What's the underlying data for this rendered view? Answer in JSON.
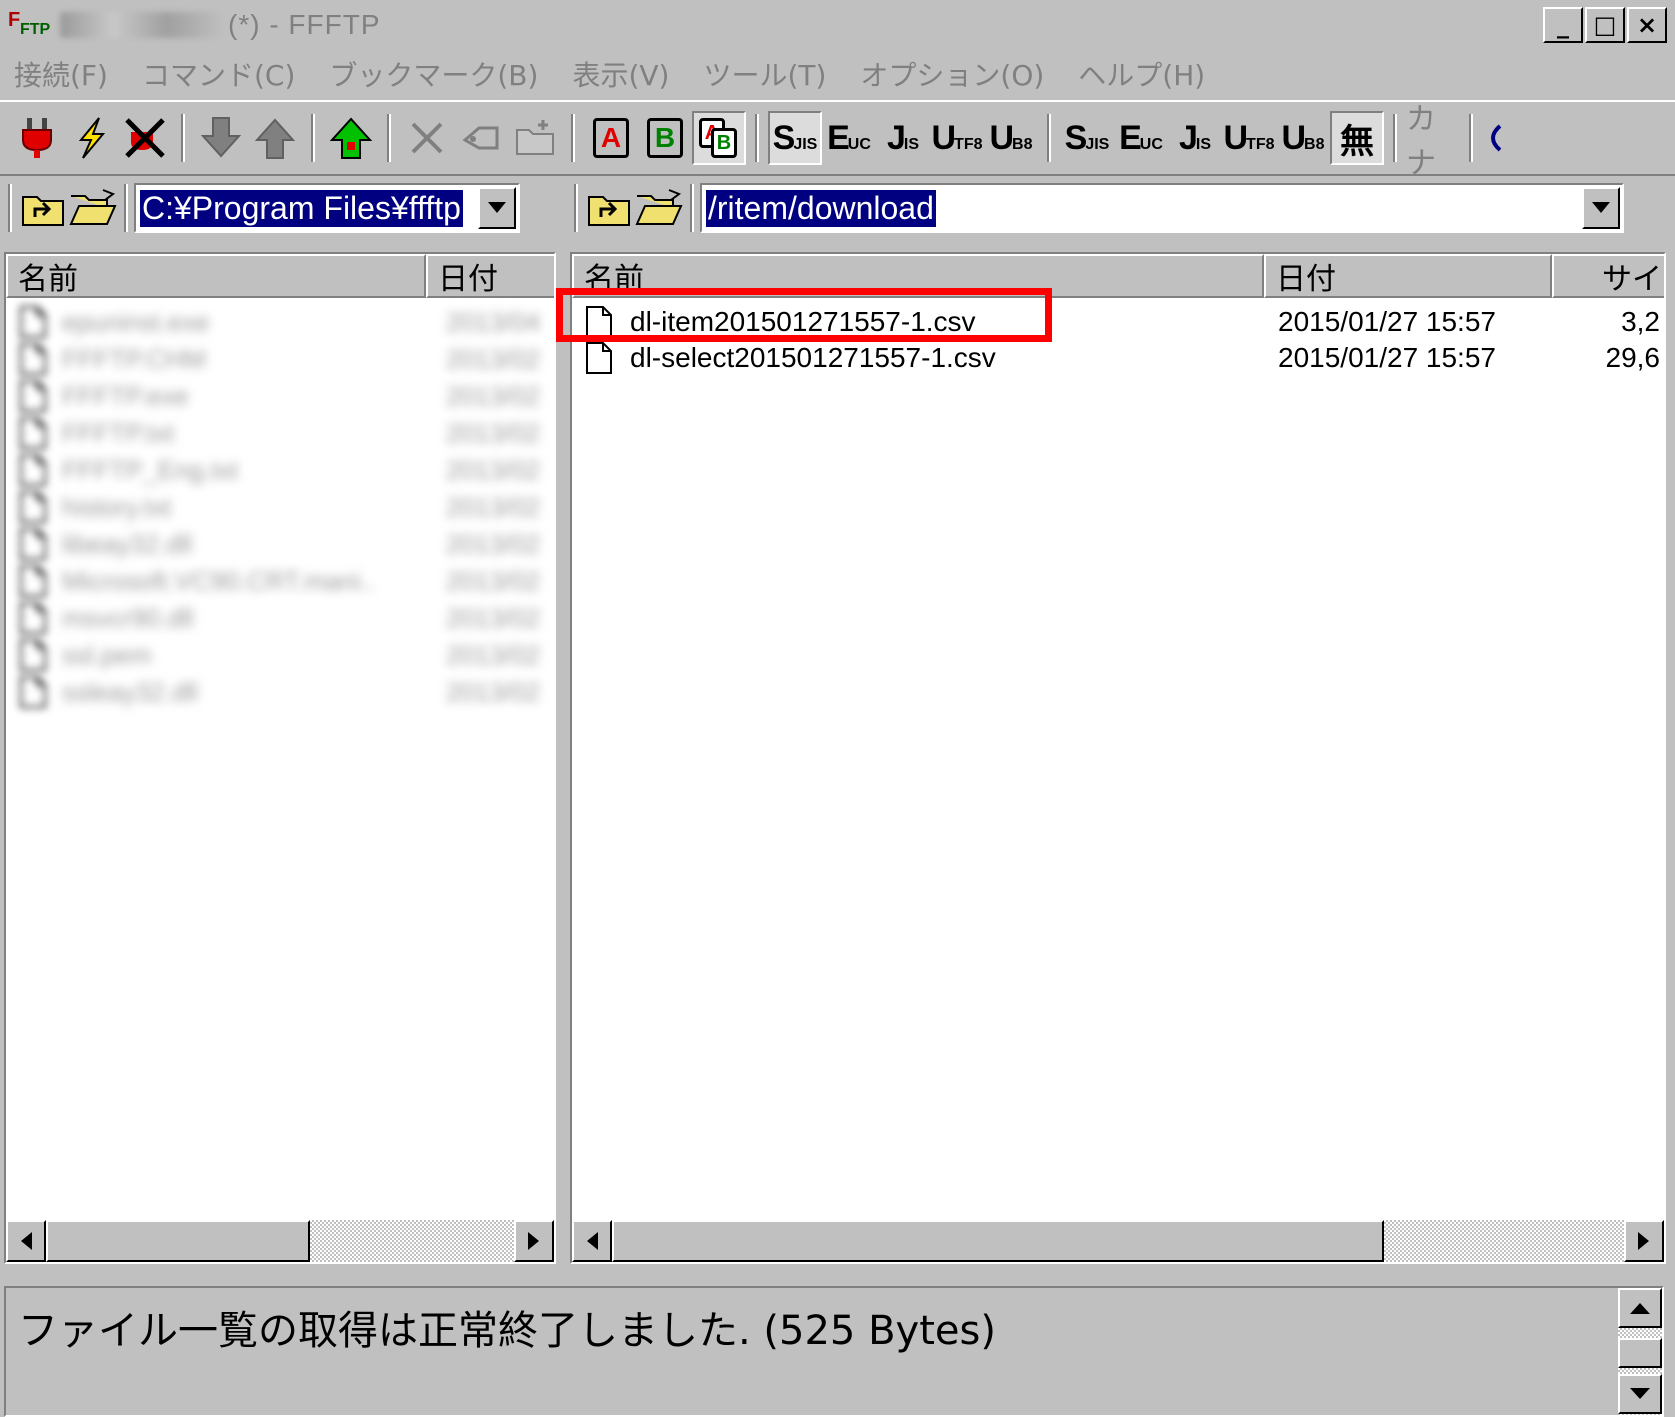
{
  "window": {
    "title_suffix": "(*) - FFFTP",
    "controls": {
      "minimize": "_",
      "maximize": "□",
      "close": "×"
    }
  },
  "menu": [
    "接続(F)",
    "コマンド(C)",
    "ブックマーク(B)",
    "表示(V)",
    "ツール(T)",
    "オプション(O)",
    "ヘルプ(H)"
  ],
  "toolbar": {
    "icons": [
      "connect-icon",
      "quick-connect-icon",
      "disconnect-icon",
      "download-icon",
      "upload-icon",
      "mirror-upload-icon",
      "delete-icon",
      "rename-icon",
      "mkdir-icon",
      "ascii-mode",
      "binary-mode",
      "auto-mode",
      "sjis-remote",
      "euc-remote",
      "jis-remote",
      "utf8n-remote",
      "utf8bom-remote",
      "sjis-local",
      "euc-local",
      "jis-local",
      "utf8n-local",
      "utf8bom-local",
      "no-conversion",
      "kana-conversion",
      "sync-icon"
    ],
    "ascii_label": "A",
    "binary_label": "B",
    "auto_label_a": "A",
    "auto_label_b": "B",
    "s_label": "S",
    "s_sub": "JIS",
    "e_label": "E",
    "e_sub": "UC",
    "j_label": "J",
    "j_sub": "IS",
    "u_label": "U",
    "u8_sub_tf": "TF",
    "u8_sub_8": "8",
    "ub_sub": "B",
    "no_conv": "無",
    "kana": "カナ"
  },
  "local": {
    "path": "C:¥Program Files¥ffftp",
    "columns": {
      "name": "名前",
      "date": "日付"
    },
    "files": [
      {
        "name": "epuninst.exe",
        "date": "2013/04"
      },
      {
        "name": "FFFTP.CHM",
        "date": "2013/02"
      },
      {
        "name": "FFFTP.exe",
        "date": "2013/02"
      },
      {
        "name": "FFFTP.txt",
        "date": "2013/02"
      },
      {
        "name": "FFFTP_Eng.txt",
        "date": "2013/02"
      },
      {
        "name": "history.txt",
        "date": "2013/02"
      },
      {
        "name": "libeay32.dll",
        "date": "2013/02"
      },
      {
        "name": "Microsoft.VC90.CRT.mani..",
        "date": "2013/02"
      },
      {
        "name": "msvcr90.dll",
        "date": "2013/02"
      },
      {
        "name": "ssl.pem",
        "date": "2013/02"
      },
      {
        "name": "ssleay32.dll",
        "date": "2013/02"
      }
    ]
  },
  "remote": {
    "path": "/ritem/download",
    "columns": {
      "name": "名前",
      "date": "日付",
      "size": "サイ"
    },
    "files": [
      {
        "name": "dl-item201501271557-1.csv",
        "date": "2015/01/27 15:57",
        "size": "3,2"
      },
      {
        "name": "dl-select201501271557-1.csv",
        "date": "2015/01/27 15:57",
        "size": "29,6"
      }
    ]
  },
  "status": {
    "log": "ファイル一覧の取得は正常終了しました. (525 Bytes)"
  },
  "colors": {
    "face": "#c0c0c0",
    "selection": "#000080",
    "highlight": "#ff0000"
  }
}
